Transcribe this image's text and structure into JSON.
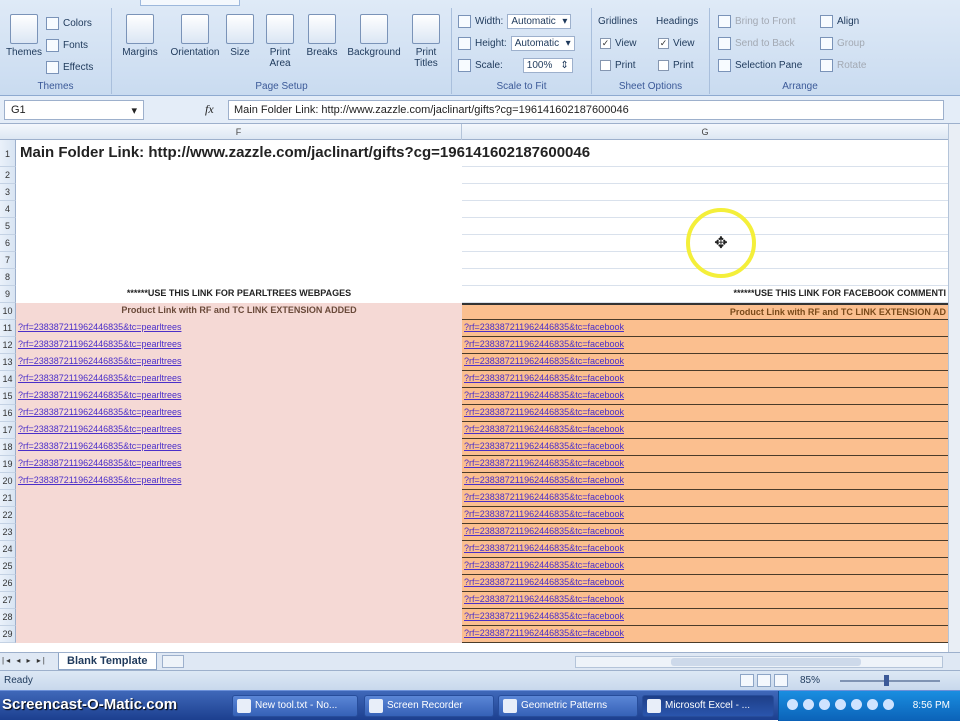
{
  "ribbon": {
    "groups": [
      {
        "id": "themes",
        "label": "Themes"
      },
      {
        "id": "page_setup",
        "label": "Page Setup"
      },
      {
        "id": "scale_to_fit",
        "label": "Scale to Fit"
      },
      {
        "id": "sheet_options",
        "label": "Sheet Options"
      },
      {
        "id": "arrange",
        "label": "Arrange"
      }
    ],
    "themes": {
      "big": "Themes",
      "colors": "Colors",
      "fonts": "Fonts",
      "effects": "Effects"
    },
    "page_setup": {
      "margins": "Margins",
      "orientation": "Orientation",
      "size": "Size",
      "print_area": "Print Area",
      "breaks": "Breaks",
      "background": "Background",
      "print_titles": "Print Titles"
    },
    "scale": {
      "width_label": "Width:",
      "width_value": "Automatic",
      "height_label": "Height:",
      "height_value": "Automatic",
      "scale_label": "Scale:",
      "scale_value": "100%"
    },
    "sheet_options": {
      "gridlines": "Gridlines",
      "headings": "Headings",
      "view": "View",
      "print": "Print"
    },
    "arrange": {
      "bring_front": "Bring to Front",
      "send_back": "Send to Back",
      "selection_pane": "Selection Pane",
      "align": "Align",
      "group": "Group",
      "rotate": "Rotate"
    }
  },
  "formula_bar": {
    "name_box": "G1",
    "fx": "fx",
    "content": "Main Folder Link:  http://www.zazzle.com/jaclinart/gifts?cg=196141602187600046"
  },
  "columns": {
    "f": "F",
    "g": "G"
  },
  "title_cell": "Main Folder Link:  http://www.zazzle.com/jaclinart/gifts?cg=196141602187600046",
  "row9": {
    "f": "******USE THIS LINK FOR PEARLTREES WEBPAGES",
    "g": "******USE THIS LINK FOR FACEBOOK COMMENTI"
  },
  "row10": {
    "f": "Product Link with RF and TC LINK EXTENSION ADDED",
    "g": "Product Link with RF and TC LINK EXTENSION AD"
  },
  "link_pearltrees": "?rf=238387211962446835&tc=pearltrees",
  "link_facebook": "?rf=238387211962446835&tc=facebook",
  "row_numbers": [
    "1",
    "2",
    "3",
    "4",
    "5",
    "6",
    "7",
    "8",
    "9",
    "10",
    "11",
    "12",
    "13",
    "14",
    "15",
    "16",
    "17",
    "18",
    "19",
    "20",
    "21",
    "22",
    "23",
    "24",
    "25",
    "26",
    "27",
    "28",
    "29"
  ],
  "sheet_tab": "Blank Template",
  "status": {
    "ready": "Ready",
    "zoom": "85%"
  },
  "taskbar": {
    "watermark": "Screencast-O-Matic.com",
    "buttons": [
      "New tool.txt - No...",
      "Screen Recorder",
      "Geometric Patterns",
      "Microsoft Excel - ..."
    ],
    "clock": "8:56 PM"
  }
}
